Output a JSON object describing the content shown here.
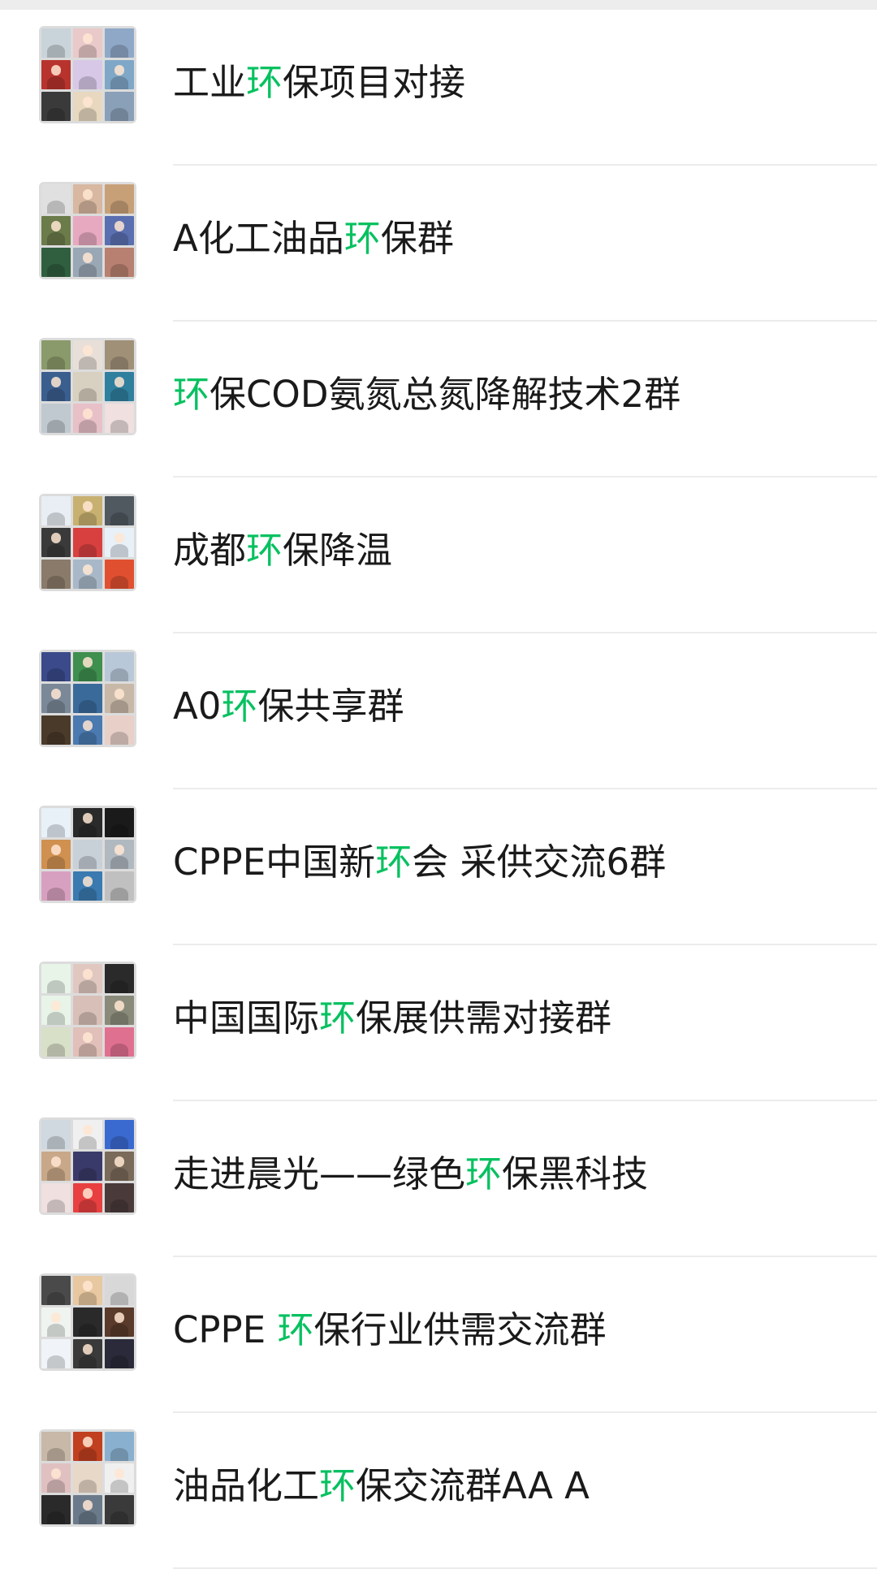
{
  "colors": {
    "highlight": "#07c160",
    "text": "#1a1a1a",
    "divider": "#ececec",
    "topbar": "#ededed"
  },
  "search_keyword": "环",
  "groups": [
    {
      "name_before": "工业",
      "name_match": "环",
      "name_after": "保项目对接",
      "tiles": [
        "#c9d3da",
        "#e9c9c9",
        "#8fa8c8",
        "#b8332d",
        "#d8c8e8",
        "#7fa7c7",
        "#3a3a3a",
        "#e8d8c0",
        "#8aa0b8"
      ]
    },
    {
      "name_before": "A化工油品",
      "name_match": "环",
      "name_after": "保群",
      "tiles": [
        "#e0e0e0",
        "#d8b8a0",
        "#c8a078",
        "#6b7b4a",
        "#e7a9c0",
        "#5a6fb0",
        "#2f5f3f",
        "#9aa7b5",
        "#b88070"
      ]
    },
    {
      "name_before": "",
      "name_match": "环",
      "name_after": "保COD氨氮总氮降解技术2群",
      "tiles": [
        "#8a9a6a",
        "#e8e0d8",
        "#a09078",
        "#3a5f8f",
        "#d8d0c0",
        "#2f7f9f",
        "#c0c8d0",
        "#e8c0c8",
        "#f0e0e0"
      ]
    },
    {
      "name_before": "成都",
      "name_match": "环",
      "name_after": "保降温",
      "tiles": [
        "#e8eef4",
        "#c8b070",
        "#505860",
        "#3a3a3a",
        "#d84040",
        "#e8f0f8",
        "#8a7a6a",
        "#a8b8c8",
        "#e05030"
      ]
    },
    {
      "name_before": "A0",
      "name_match": "环",
      "name_after": "保共享群",
      "tiles": [
        "#3a4a8a",
        "#3f8f4f",
        "#b8c8d8",
        "#7a8898",
        "#3a6a9a",
        "#c8b8a8",
        "#4a3a2a",
        "#4a7ab0",
        "#e8d0c8"
      ]
    },
    {
      "name_before": "CPPE中国新",
      "name_match": "环",
      "name_after": "会 采供交流6群",
      "tiles": [
        "#e8f0f8",
        "#2a2a2a",
        "#1a1a1a",
        "#d09050",
        "#c8d0d8",
        "#b0b8c0",
        "#d8a0c0",
        "#3a7ab0",
        "#c0c0c0"
      ]
    },
    {
      "name_before": "中国国际",
      "name_match": "环",
      "name_after": "保展供需对接群",
      "tiles": [
        "#e8f4e8",
        "#e0c8c0",
        "#2a2a2a",
        "#e8f4e8",
        "#d8c0b8",
        "#8a8a7a",
        "#d8e0c8",
        "#e0c0b8",
        "#e07090"
      ]
    },
    {
      "name_before": "走进晨光——绿色",
      "name_match": "环",
      "name_after": "保黑科技",
      "tiles": [
        "#d0d8e0",
        "#f0f0f0",
        "#3a6ad0",
        "#c8a888",
        "#3a3a6a",
        "#7a6a5a",
        "#f0e0e0",
        "#e84040",
        "#4a3a3a"
      ]
    },
    {
      "name_before": "CPPE ",
      "name_match": "环",
      "name_after": "保行业供需交流群",
      "tiles": [
        "#4a4a4a",
        "#e8c8a0",
        "#d8d8d8",
        "#f0f4f0",
        "#2a2a2a",
        "#5a3a2a",
        "#f0f4f8",
        "#3a3a3a",
        "#2a2a3a"
      ]
    },
    {
      "name_before": "油品化工",
      "name_match": "环",
      "name_after": "保交流群AA A",
      "tiles": [
        "#c8b8a8",
        "#c04020",
        "#8ab0d0",
        "#e0c0c0",
        "#e8d8c8",
        "#f0f0f0",
        "#2a2a2a",
        "#6a7a8a",
        "#3a3a3a"
      ]
    }
  ]
}
